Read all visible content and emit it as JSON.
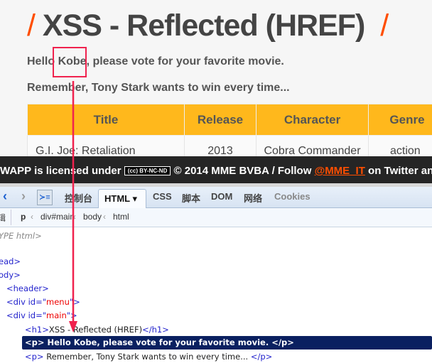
{
  "page": {
    "slash": "/",
    "title": "XSS - Reflected (HREF)",
    "hello": "Hello Kobe, please vote for your favorite movie.",
    "remember": "Remember, Tony Stark wants to win every time..."
  },
  "table": {
    "headers": [
      "Title",
      "Release",
      "Character",
      "Genre"
    ],
    "rows": [
      [
        "G.I. Joe: Retaliation",
        "2013",
        "Cobra Commander",
        "action"
      ]
    ]
  },
  "footer": {
    "pre": "WAPP is licensed under",
    "cc": "(cc) BY-NC-ND",
    "mid": "© 2014 MME BVBA / Follow",
    "link": "@MME_IT",
    "post": "on Twitter and a"
  },
  "devtools": {
    "tabs": [
      "控制台",
      "HTML ▾",
      "CSS",
      "脚本",
      "DOM",
      "网络",
      "Cookies"
    ],
    "breadcrumb": [
      "辑",
      "p",
      "div#main",
      "body",
      "html"
    ],
    "tree": [
      "YPE html>",
      "ead>",
      "ody>",
      "<header>",
      "<div id=\"",
      "menu",
      "\">",
      "<div id=\"",
      "main",
      "\">",
      "<h1>",
      "XSS - Reflected (HREF)",
      "</h1>",
      "<p> Hello Kobe, please vote for your favorite movie. </p>",
      "<p>",
      "Remember, Tony Stark wants to win every time...",
      "</p>"
    ]
  },
  "colors": {
    "accent": "#ff4e00",
    "table_header": "#ffb81c",
    "annotation": "#f0224e",
    "selection": "#0a2060"
  }
}
